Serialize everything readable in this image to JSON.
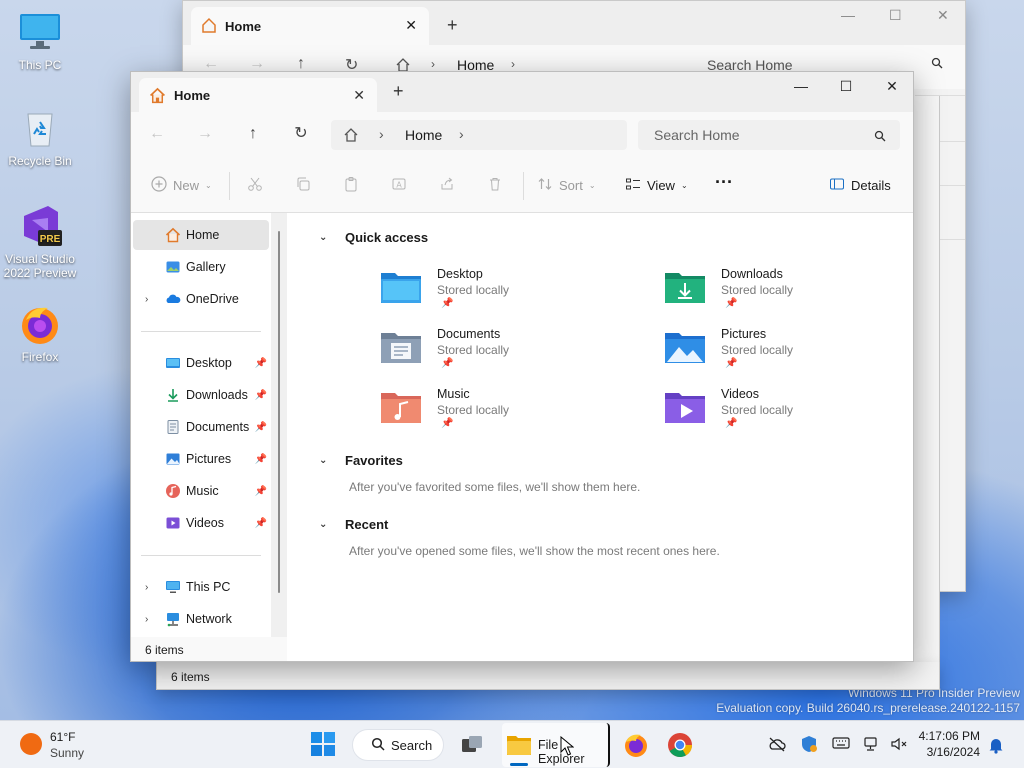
{
  "desktop": {
    "icons": [
      {
        "label": "This PC"
      },
      {
        "label": "Recycle Bin"
      },
      {
        "label": "Visual Studio 2022 Preview",
        "line1": "Visual Studio",
        "line2": "2022 Preview"
      },
      {
        "label": "Firefox"
      }
    ],
    "watermark": {
      "line1": "Windows 11 Pro Insider Preview",
      "line2": "Evaluation copy. Build 26040.rs_prerelease.240122-1157"
    }
  },
  "back_window": {
    "tab_title": "Home",
    "path": "Home",
    "search_placeholder": "Search Home",
    "status": "6 items"
  },
  "window": {
    "tab_title": "Home",
    "address": {
      "path": "Home"
    },
    "search_placeholder": "Search Home",
    "toolbar": {
      "new_label": "New",
      "sort_label": "Sort",
      "view_label": "View",
      "more_label": "···",
      "details_label": "Details"
    },
    "sidebar": {
      "top": [
        {
          "label": "Home",
          "icon": "home-icon",
          "active": true
        },
        {
          "label": "Gallery",
          "icon": "gallery-icon"
        },
        {
          "label": "OneDrive",
          "icon": "onedrive-icon",
          "expandable": true
        }
      ],
      "pinned": [
        {
          "label": "Desktop",
          "icon": "desktop-folder-icon"
        },
        {
          "label": "Downloads",
          "icon": "downloads-icon"
        },
        {
          "label": "Documents",
          "icon": "documents-icon"
        },
        {
          "label": "Pictures",
          "icon": "pictures-icon"
        },
        {
          "label": "Music",
          "icon": "music-icon"
        },
        {
          "label": "Videos",
          "icon": "videos-icon"
        }
      ],
      "bottom": [
        {
          "label": "This PC",
          "icon": "this-pc-icon"
        },
        {
          "label": "Network",
          "icon": "network-icon"
        }
      ]
    },
    "sections": {
      "quick_access": "Quick access",
      "favorites": "Favorites",
      "favorites_note": "After you've favorited some files, we'll show them here.",
      "recent": "Recent",
      "recent_note": "After you've opened some files, we'll show the most recent ones here."
    },
    "quick_access_items": [
      {
        "name": "Desktop",
        "sub": "Stored locally"
      },
      {
        "name": "Downloads",
        "sub": "Stored locally"
      },
      {
        "name": "Documents",
        "sub": "Stored locally"
      },
      {
        "name": "Pictures",
        "sub": "Stored locally"
      },
      {
        "name": "Music",
        "sub": "Stored locally"
      },
      {
        "name": "Videos",
        "sub": "Stored locally"
      }
    ],
    "status": "6 items"
  },
  "taskbar": {
    "weather": {
      "temp": "61°F",
      "condition": "Sunny"
    },
    "search_label": "Search",
    "file_explorer_label": "File Explorer",
    "clock": {
      "time": "4:17:06 PM",
      "date": "3/16/2024"
    }
  },
  "colors": {
    "accent": "#0067c0",
    "folder_yellow": "#f4c242"
  }
}
